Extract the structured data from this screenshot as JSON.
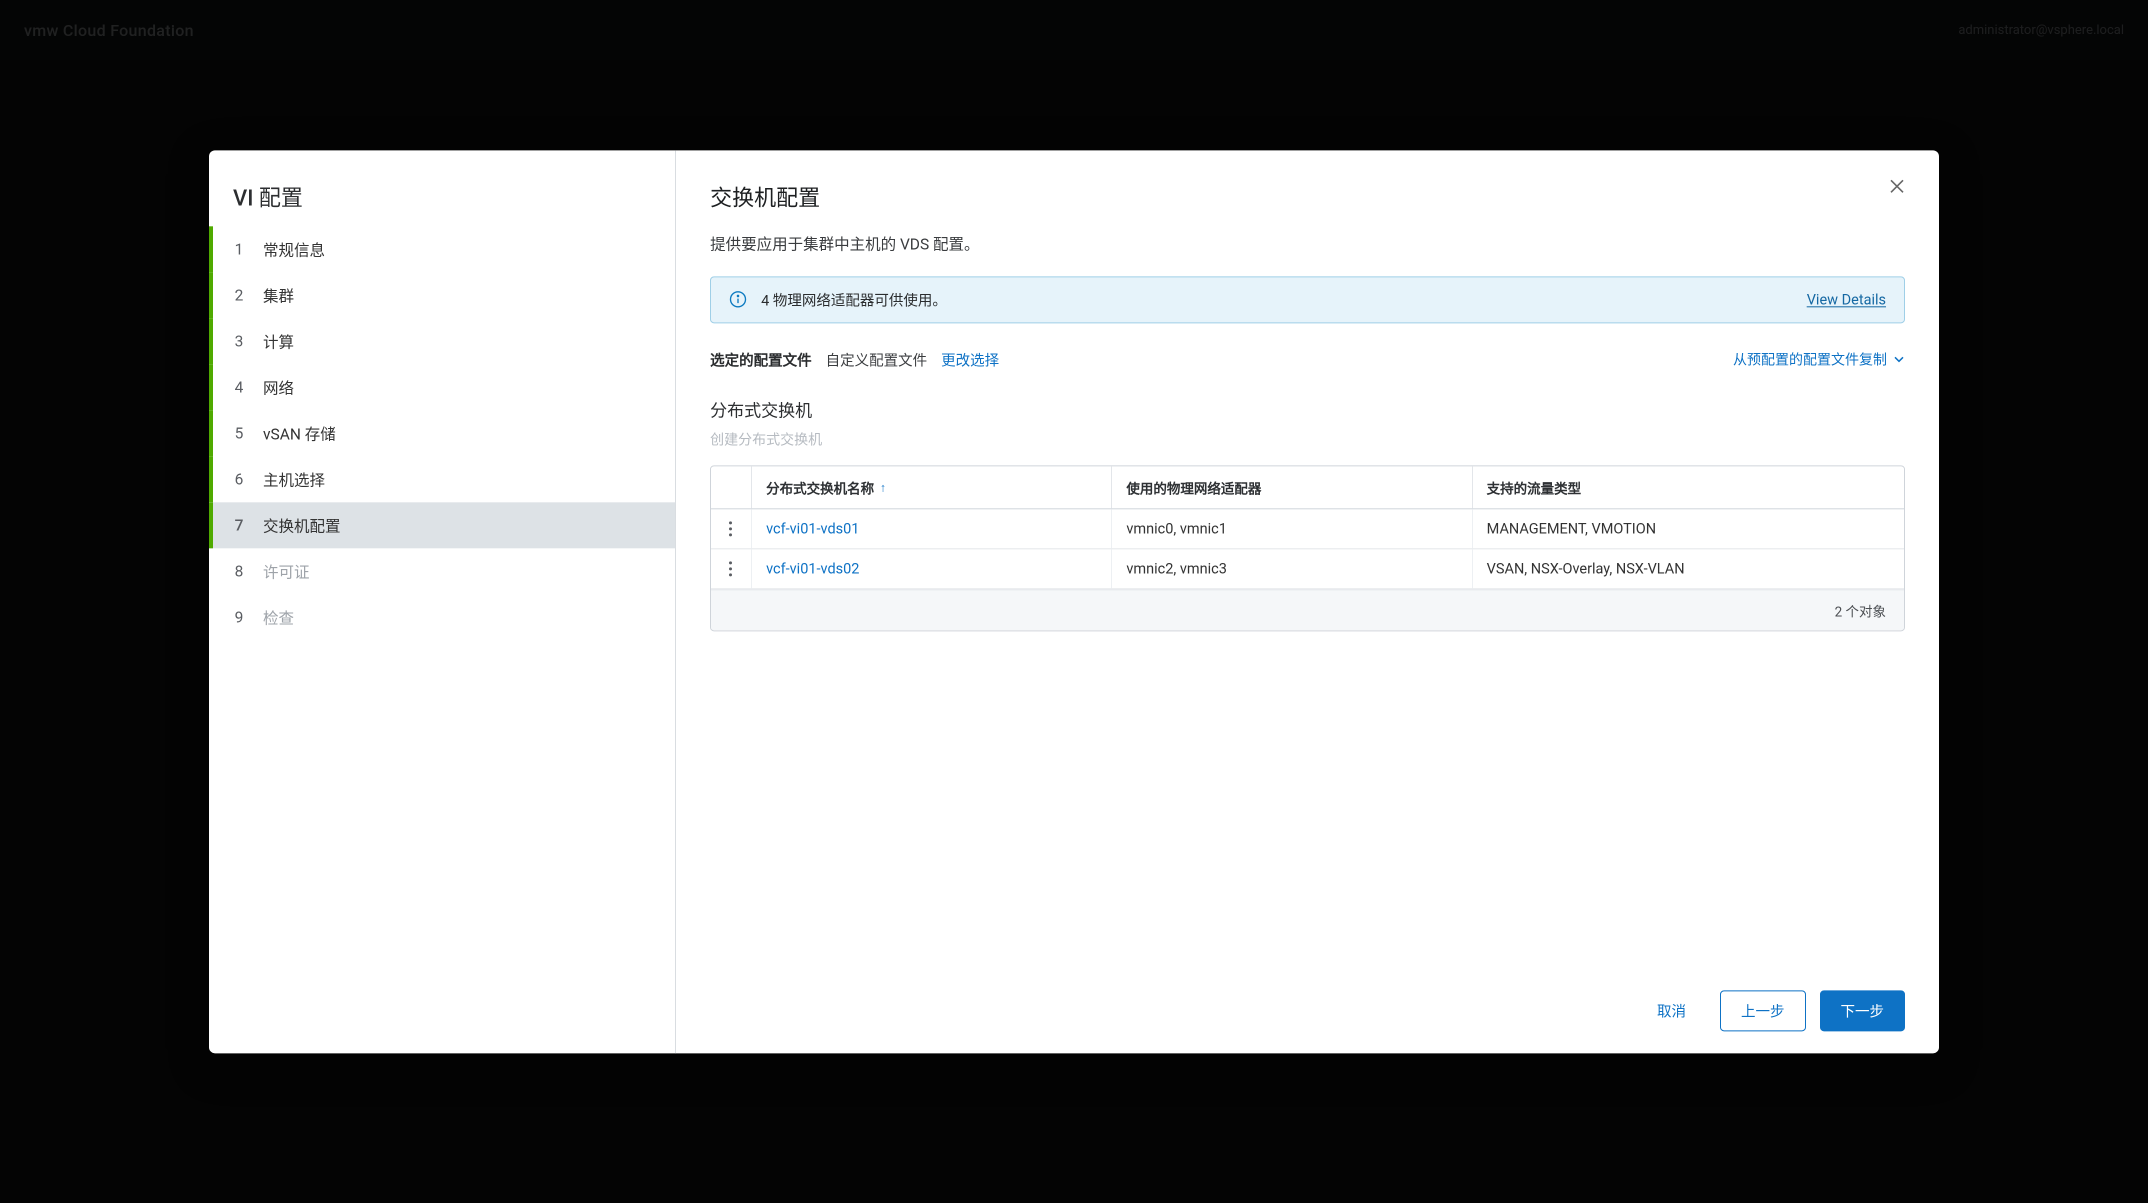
{
  "backdrop": {
    "brand": "vmw Cloud Foundation",
    "user_text": "administrator@vsphere.local"
  },
  "modal": {
    "title": "VI 配置",
    "steps": [
      {
        "num": "1",
        "label": "常规信息",
        "state": "done"
      },
      {
        "num": "2",
        "label": "集群",
        "state": "done"
      },
      {
        "num": "3",
        "label": "计算",
        "state": "done"
      },
      {
        "num": "4",
        "label": "网络",
        "state": "done"
      },
      {
        "num": "5",
        "label": "vSAN 存储",
        "state": "done"
      },
      {
        "num": "6",
        "label": "主机选择",
        "state": "done"
      },
      {
        "num": "7",
        "label": "交换机配置",
        "state": "active"
      },
      {
        "num": "8",
        "label": "许可证",
        "state": "pending"
      },
      {
        "num": "9",
        "label": "检查",
        "state": "pending"
      }
    ],
    "right_title": "交换机配置",
    "subtitle": "提供要应用于集群中主机的 VDS 配置。",
    "info": {
      "message": "4 物理网络适配器可供使用。",
      "details": "View Details"
    },
    "profile": {
      "label": "选定的配置文件",
      "value": "自定义配置文件",
      "change": "更改选择",
      "copy_from": "从预配置的配置文件复制"
    },
    "section_title": "分布式交换机",
    "create_link": "创建分布式交换机",
    "table": {
      "headers": {
        "name": "分布式交换机名称",
        "pnics": "使用的物理网络适配器",
        "traffic": "支持的流量类型"
      },
      "rows": [
        {
          "name": "vcf-vi01-vds01",
          "pnics": "vmnic0, vmnic1",
          "traffic": "MANAGEMENT, VMOTION"
        },
        {
          "name": "vcf-vi01-vds02",
          "pnics": "vmnic2, vmnic3",
          "traffic": "VSAN, NSX-Overlay, NSX-VLAN"
        }
      ],
      "footer": "2 个对象"
    },
    "buttons": {
      "cancel": "取消",
      "back": "上一步",
      "next": "下一步"
    }
  }
}
